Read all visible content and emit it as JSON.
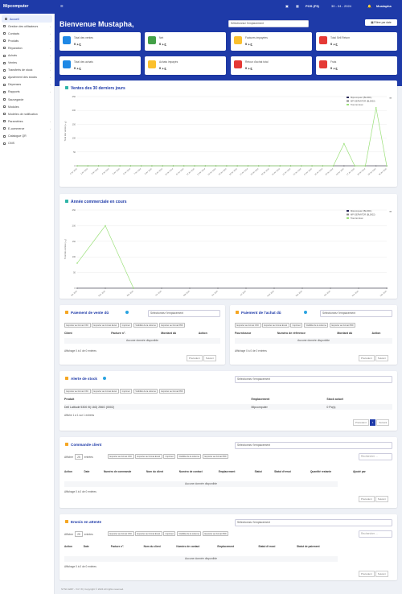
{
  "topbar": {
    "brand": "Mipcomputer",
    "pos": "POS (F9)",
    "date": "30 - 04 - 2024",
    "user": "Mustapha"
  },
  "sidebar": {
    "items": [
      {
        "label": "Accueil",
        "active": true,
        "chev": false
      },
      {
        "label": "Gestion des utilisateurs",
        "chev": true
      },
      {
        "label": "Contacts",
        "chev": true
      },
      {
        "label": "Produits",
        "chev": true
      },
      {
        "label": "Réparation",
        "chev": true
      },
      {
        "label": "Achats",
        "chev": true
      },
      {
        "label": "Ventes",
        "chev": true
      },
      {
        "label": "Transferts de stock",
        "chev": true
      },
      {
        "label": "Ajustement des stocks",
        "chev": true
      },
      {
        "label": "Dépenses",
        "chev": true
      },
      {
        "label": "Rapports",
        "chev": true
      },
      {
        "label": "Sauvegarde",
        "chev": false
      },
      {
        "label": "Modules",
        "chev": false
      },
      {
        "label": "Modèles de notification",
        "chev": false
      },
      {
        "label": "Paramètres",
        "chev": true
      },
      {
        "label": "E-commerce",
        "chev": true
      },
      {
        "label": "Catalogue QR",
        "chev": false
      },
      {
        "label": "CMS",
        "chev": false
      }
    ]
  },
  "header": {
    "title": "Bienvenue Mustapha,",
    "location_placeholder": "Sélectionnez l'emplacement",
    "filter_label": "Filtrer par date"
  },
  "stats": [
    {
      "label": "Total des ventes",
      "value": "0 ج.د",
      "color": "#1e88e5"
    },
    {
      "label": "Net",
      "value": "0 ج.د",
      "color": "#43a047"
    },
    {
      "label": "Factures impayées",
      "value": "0 ج.د",
      "color": "#fbc02d"
    },
    {
      "label": "Total Sell Return",
      "value": "0 ج.د",
      "color": "#e53935"
    },
    {
      "label": "Total des achats",
      "value": "0 ج.د",
      "color": "#1e88e5"
    },
    {
      "label": "Achats impayés",
      "value": "0 ج.د",
      "color": "#fbc02d"
    },
    {
      "label": "Retour d'achat total",
      "value": "0 ج.د",
      "color": "#e53935"
    },
    {
      "label": "Frais",
      "value": "0 ج.د",
      "color": "#e53935"
    }
  ],
  "sales30": {
    "title": "Ventes des 30 derniers jours",
    "chart_data": {
      "type": "line",
      "title": "Ventes des 30 derniers jours",
      "ylabel": "Total des ventes (ج.د)",
      "ylim": [
        0,
        250
      ],
      "yticks": [
        0,
        50,
        100,
        150,
        200,
        250
      ],
      "categories": [
        "1 avr 2024",
        "2 avr 2024",
        "3 avr 2024",
        "4 avr 2024",
        "5 avr 2024",
        "6 avr 2024",
        "7 avr 2024",
        "8 avr 2024",
        "9 avr 2024",
        "10 avr 2024",
        "11 avr 2024",
        "12 avr 2024",
        "13 avr 2024",
        "14 avr 2024",
        "15 avr 2024",
        "16 avr 2024",
        "17 avr 2024",
        "18 avr 2024",
        "19 avr 2024",
        "20 avr 2024",
        "21 avr 2024",
        "22 avr 2024",
        "23 avr 2024",
        "24 avr 2024",
        "25 avr 2024",
        "26 avr 2024",
        "27 avr 2024",
        "28 avr 2024",
        "29 avr 2024",
        "30 avr 2024"
      ],
      "series": [
        {
          "name": "Mipcomputer (BL0001)",
          "color": "#2b2b5a",
          "values": [
            0,
            0,
            0,
            0,
            0,
            0,
            0,
            0,
            0,
            0,
            0,
            0,
            0,
            0,
            0,
            0,
            0,
            0,
            0,
            0,
            0,
            0,
            0,
            0,
            0,
            0,
            0,
            0,
            0,
            0
          ]
        },
        {
          "name": "MPI SERVATOR (BL0002)",
          "color": "#8a8a8a",
          "values": [
            0,
            0,
            0,
            0,
            0,
            0,
            0,
            0,
            0,
            0,
            0,
            0,
            0,
            0,
            0,
            0,
            0,
            0,
            0,
            0,
            0,
            0,
            0,
            0,
            0,
            0,
            0,
            0,
            0,
            0
          ]
        },
        {
          "name": "Tous les lieux",
          "color": "#9be07a",
          "values": [
            0,
            0,
            0,
            0,
            0,
            0,
            0,
            0,
            0,
            0,
            0,
            0,
            0,
            0,
            0,
            0,
            0,
            0,
            0,
            0,
            0,
            0,
            0,
            0,
            0,
            80,
            0,
            0,
            210,
            0
          ]
        }
      ],
      "legend": "top-right"
    }
  },
  "yearly": {
    "title": "Année commerciale en cours",
    "chart_data": {
      "type": "line",
      "title": "Année commerciale en cours",
      "ylabel": "Total des ventes (ج.د)",
      "ylim": [
        0,
        250
      ],
      "yticks": [
        0,
        50,
        100,
        150,
        200,
        250
      ],
      "categories": [
        "Jan 2024",
        "Févr 2024",
        "Mar 2024",
        "Avr 2024",
        "Mai 2024",
        "Jun 2024",
        "Jul 2024",
        "Août 2024",
        "Sep 2024",
        "Oct 2024",
        "Nov 2024",
        "Déc 2024"
      ],
      "series": [
        {
          "name": "Mipcomputer (BL0001)",
          "color": "#2b2b5a",
          "values": [
            0,
            0,
            0,
            0,
            0,
            0,
            0,
            0,
            0,
            0,
            0,
            0
          ]
        },
        {
          "name": "MPI SERVATOR (BL0002)",
          "color": "#8a8a8a",
          "values": [
            0,
            0,
            0,
            0,
            0,
            0,
            0,
            0,
            0,
            0,
            0,
            0
          ]
        },
        {
          "name": "Tous les lieux",
          "color": "#9be07a",
          "values": [
            80,
            200,
            0,
            null,
            null,
            null,
            null,
            null,
            null,
            null,
            null,
            null
          ]
        }
      ],
      "legend": "top-right"
    }
  },
  "export_buttons": [
    "Exporter au format CSV",
    "Exporter au format Excel",
    "Imprimer",
    "Visibilité de la colonne",
    "Exporter au format PDF"
  ],
  "sales_due": {
    "title": "Paiement de vente dû",
    "placeholder": "Sélectionnez l'emplacement",
    "columns": [
      "Client",
      "Facture n°.",
      "Montant dû",
      "Action"
    ],
    "empty": "Aucune donnée disponible",
    "info": "Affichage 0 à 0 de 0 entrées",
    "prev": "Précédent",
    "next": "Suivant"
  },
  "purchase_due": {
    "title": "Paiement de l'achat dû",
    "placeholder": "Sélectionnez l'emplacement",
    "columns": [
      "Fournisseur",
      "Numéro de référence",
      "Montant dû",
      "Action"
    ],
    "empty": "Aucune donnée disponible",
    "info": "Affichage 0 à 0 de 0 entrées",
    "prev": "Précédent",
    "next": "Suivant"
  },
  "stock": {
    "title": "Alerte de stock",
    "placeholder": "Sélectionnez l'emplacement",
    "columns": [
      "Produit",
      "Emplacement",
      "Stock actuel"
    ],
    "row": [
      "Dell Latitude 5300 i5| 16G| 256G (0002)",
      "Mipcomputer",
      "0 Pc(s)"
    ],
    "info": "Affiche 1 à 1 sur 1 entrées",
    "prev": "Précédent",
    "page": "1",
    "next": "Suivant"
  },
  "orders": {
    "title": "Commande client",
    "placeholder": "Sélectionnez l'emplacement",
    "show": "Afficher",
    "count": "25",
    "entries": "entrées",
    "search": "Rechercher ...",
    "columns": [
      "Action",
      "Date",
      "Numéro de commande",
      "Nom du client",
      "Numéro de contact",
      "Emplacement",
      "Statut",
      "Statut d'envoi",
      "Quantité restante",
      "Ajouté par"
    ],
    "empty": "Aucune donnée disponible",
    "info": "Affichage 0 à 0 de 0 entrées",
    "prev": "Précédent",
    "next": "Suivant"
  },
  "shipments": {
    "title": "Envois en attente",
    "placeholder": "Sélectionnez l'emplacement",
    "show": "Afficher",
    "count": "25",
    "entries": "entrées",
    "search": "Rechercher ...",
    "columns": [
      "Action",
      "Date",
      "Facture n°.",
      "Nom du client",
      "Numéro de contact",
      "Emplacement",
      "Statut d'envoi",
      "Statut de paiement"
    ],
    "empty": "Aucune donnée disponible",
    "info": "Affichage 0 à 0 de 0 entrées",
    "prev": "Précédent",
    "next": "Suivant"
  },
  "footer": "SYNC ERP - V4.7.8 | Copyright © 2024 All rights reserved."
}
